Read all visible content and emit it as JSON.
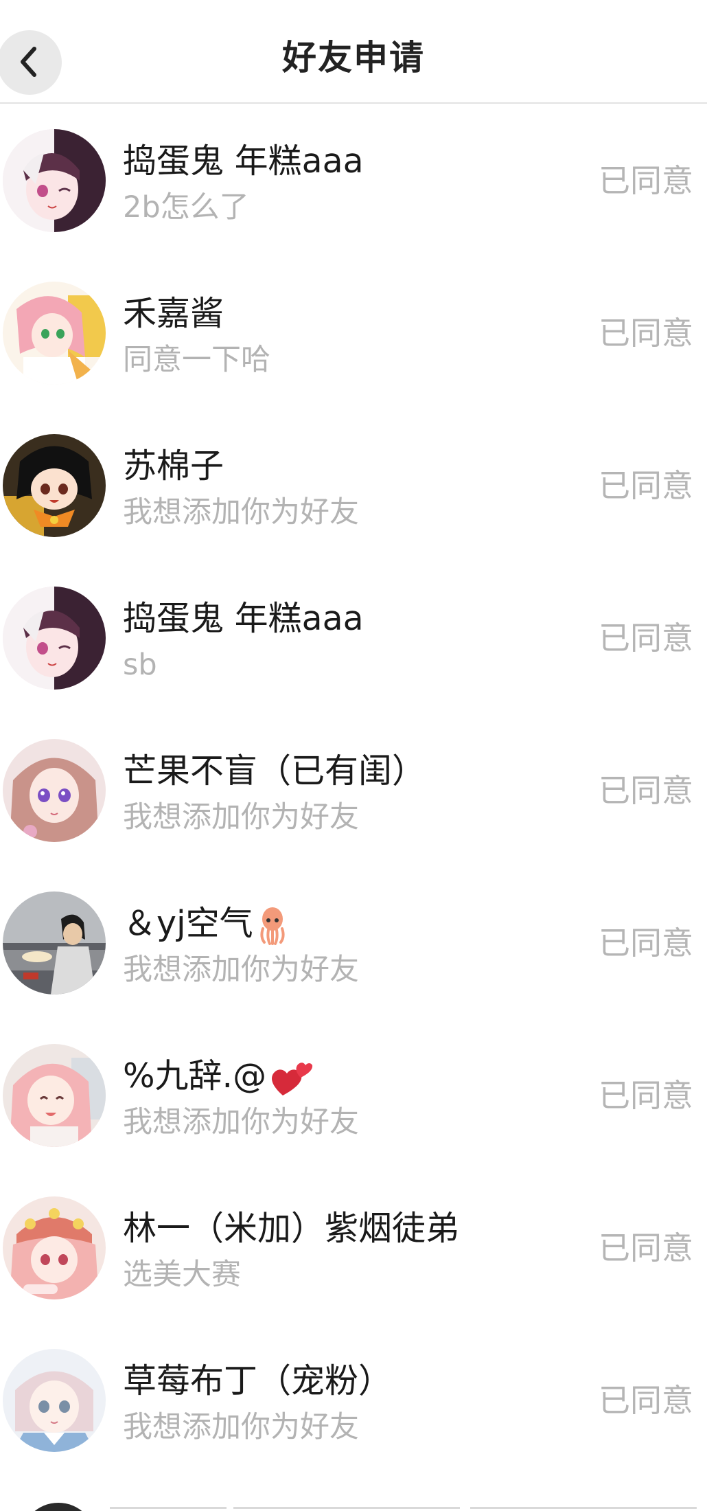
{
  "header": {
    "title": "好友申请",
    "back_icon": "chevron-left-icon"
  },
  "requests": [
    {
      "name": "捣蛋鬼  年糕aaa",
      "message": "2b怎么了",
      "status": "已同意",
      "avatar": "anime-girl-white-black-hair"
    },
    {
      "name": "禾嘉酱",
      "message": "同意一下哈",
      "status": "已同意",
      "avatar": "anime-girl-pink-hair"
    },
    {
      "name": "苏棉子",
      "message": "我想添加你为好友",
      "status": "已同意",
      "avatar": "anime-boy-black-hair-orange"
    },
    {
      "name": "捣蛋鬼  年糕aaa",
      "message": "sb",
      "status": "已同意",
      "avatar": "anime-girl-white-black-hair"
    },
    {
      "name": "芒果不盲（已有闺）",
      "message": "我想添加你为好友",
      "status": "已同意",
      "avatar": "anime-girl-purple-eyes"
    },
    {
      "name": "＆yj空气",
      "message": "我想添加你为好友",
      "status": "已同意",
      "avatar": "anime-boy-seaside",
      "emoji": "squid-icon"
    },
    {
      "name": "%九辞.@",
      "message": "我想添加你为好友",
      "status": "已同意",
      "avatar": "anime-girl-pink-hair-light",
      "emoji": "two-hearts-icon"
    },
    {
      "name": "林一（米加）紫烟徒弟",
      "message": "选美大赛",
      "status": "已同意",
      "avatar": "anime-girl-pink-hat"
    },
    {
      "name": "草莓布丁（宠粉）",
      "message": "我想添加你为好友",
      "status": "已同意",
      "avatar": "anime-girl-light-hair"
    }
  ],
  "colors": {
    "title": "#222222",
    "name": "#1a1a1a",
    "message": "#b3b3b3",
    "status": "#b5b5b5",
    "divider": "#e3e3e3"
  }
}
